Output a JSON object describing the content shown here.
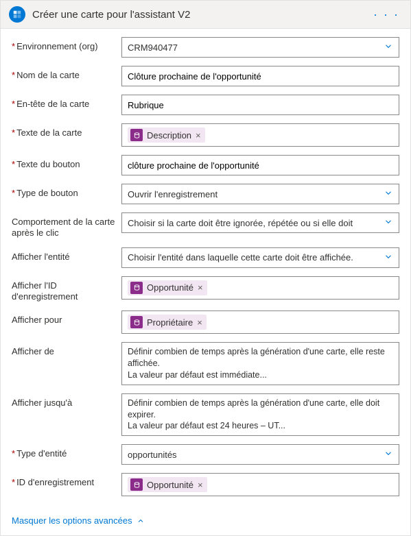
{
  "header": {
    "title": "Créer une carte pour l'assistant V2"
  },
  "fields": {
    "env": {
      "label": "Environnement (org)",
      "required": true,
      "value": "CRM940477"
    },
    "cardName": {
      "label": "Nom de la carte",
      "required": true,
      "value": "Clôture prochaine de l'opportunité"
    },
    "cardHeader": {
      "label": "En-tête de la carte",
      "required": true,
      "value": "Rubrique"
    },
    "cardText": {
      "label": "Texte de la carte",
      "required": true,
      "tokenLabel": "Description"
    },
    "buttonText": {
      "label": "Texte du bouton",
      "required": true,
      "value": "clôture prochaine de l'opportunité"
    },
    "buttonType": {
      "label": "Type de bouton",
      "required": true,
      "value": "Ouvrir l'enregistrement"
    },
    "afterClick": {
      "label": "Comportement de la carte après le clic",
      "required": false,
      "placeholder": "Choisir si la carte doit être ignorée, répétée ou si elle doit"
    },
    "displayEntity": {
      "label": "Afficher l'entité",
      "required": false,
      "placeholder": "Choisir l'entité dans laquelle cette carte doit être affichée."
    },
    "displayRecordId": {
      "label": "Afficher l'ID d'enregistrement",
      "required": false,
      "tokenLabel": "Opportunité"
    },
    "displayFor": {
      "label": "Afficher pour",
      "required": false,
      "tokenLabel": "Propriétaire"
    },
    "displayFrom": {
      "label": "Afficher de",
      "required": false,
      "line1": "Définir combien de temps après la génération d'une carte, elle reste affichée.",
      "line2": "La valeur par défaut est immédiate..."
    },
    "displayUntil": {
      "label": "Afficher jusqu'à",
      "required": false,
      "line1": "Définir combien de temps après la génération d'une carte, elle doit expirer.",
      "line2": "La valeur par défaut est 24 heures – UT..."
    },
    "entityType": {
      "label": "Type d'entité",
      "required": true,
      "value": "opportunités"
    },
    "recordId": {
      "label": "ID d'enregistrement",
      "required": true,
      "tokenLabel": "Opportunité"
    }
  },
  "advancedToggle": "Masquer les options avancées"
}
